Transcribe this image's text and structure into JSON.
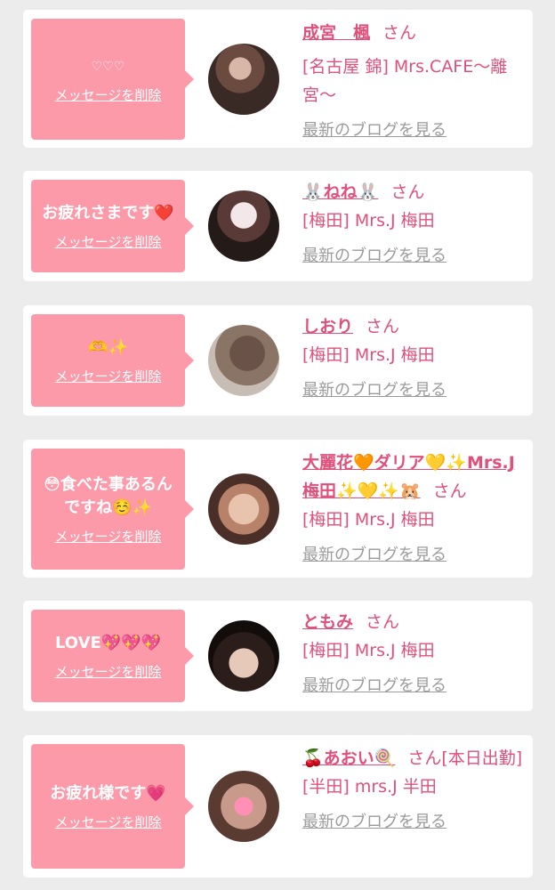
{
  "messages": [
    {
      "message": "♡♡♡",
      "delete_label": "メッセージを削除",
      "name": "成宮　楓",
      "honorific": "さん",
      "shop": "[名古屋 錦] Mrs.CAFE〜離宮〜",
      "blog_link": "最新のブログを見る"
    },
    {
      "message": "お疲れさまです❤️",
      "delete_label": "メッセージを削除",
      "name": "🐰ねね🐰",
      "honorific": "さん",
      "shop": "[梅田] Mrs.J 梅田",
      "blog_link": "最新のブログを見る"
    },
    {
      "message": "🫶✨",
      "delete_label": "メッセージを削除",
      "name": "しおり",
      "honorific": "さん",
      "shop": "[梅田] Mrs.J 梅田",
      "blog_link": "最新のブログを見る"
    },
    {
      "message": "😳食べた事あるんですね☺️✨",
      "delete_label": "メッセージを削除",
      "name": "大麗花🧡ダリア💛✨Mrs.J 梅田✨💛✨🐹",
      "honorific": "さん",
      "shop": "[梅田] Mrs.J 梅田",
      "blog_link": "最新のブログを見る"
    },
    {
      "message": "LOVE💖💖💖",
      "delete_label": "メッセージを削除",
      "name": "ともみ",
      "honorific": "さん",
      "shop": "[梅田] Mrs.J 梅田",
      "blog_link": "最新のブログを見る"
    },
    {
      "message": "お疲れ様です💗",
      "delete_label": "メッセージを削除",
      "name": "🍒あおい🍭",
      "honorific": "さん[本日出勤]",
      "shop": "[半田] mrs.J 半田",
      "blog_link": "最新のブログを見る"
    }
  ],
  "colors": {
    "bubble": "#fd9aaa",
    "accent": "#e0507a",
    "link_gray": "#9b9b9b",
    "background": "#ececec"
  }
}
